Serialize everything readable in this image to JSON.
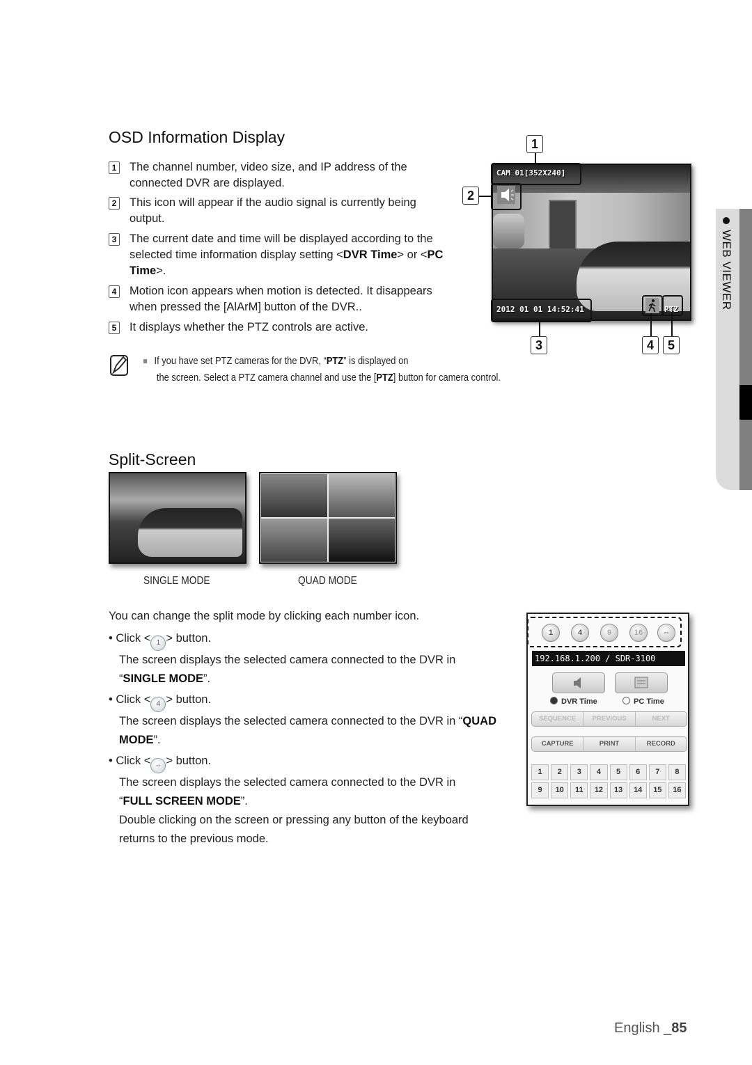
{
  "osd": {
    "title": "OSD Information Display",
    "items": [
      {
        "num": "1",
        "text": "The channel number, video size, and IP address of the connected DVR are displayed."
      },
      {
        "num": "2",
        "text": "This icon will appear if the audio signal is currently being output."
      },
      {
        "num": "3",
        "text_before": "The current date and time will be displayed according to the selected time information display setting <",
        "bold1": "DVR Time",
        "text_mid": "> or <",
        "bold2": "PC Time",
        "text_after": ">."
      },
      {
        "num": "4",
        "text": "Motion icon appears when motion is detected. It disappears when pressed the [AlArM] button of the DVR.."
      },
      {
        "num": "5",
        "text": "It displays whether the PTZ controls are active."
      }
    ],
    "camera": {
      "cam_label": "CAM 01[352X240]",
      "datetime": "2012 01 01  14:52:41",
      "ptz_label": "PTZ",
      "icons": [
        "speaker-icon",
        "motion-person-icon"
      ]
    },
    "callouts": [
      "1",
      "2",
      "3",
      "4",
      "5"
    ]
  },
  "note": {
    "icon": "note-pencil-icon",
    "line1_before": "If you have set PTZ cameras for the DVR, “",
    "line1_bold": "PTZ",
    "line1_after": "” is displayed on",
    "line2_before": "the screen. Select a PTZ camera channel and use the [",
    "line2_bold": "PTZ",
    "line2_after": "] button for camera control."
  },
  "split": {
    "title": "Split-Screen",
    "single_label": "SINGLE MODE",
    "quad_label": "QUAD MODE",
    "intro": "You can change the split mode by clicking each number icon.",
    "bullets": [
      {
        "click": "Click <",
        "icon_label": "1",
        "after": "> button.",
        "desc": "The screen displays the selected camera connected to the DVR in",
        "mode_open": "“",
        "mode": "SINGLE MODE",
        "mode_close": "”."
      },
      {
        "click": "Click <",
        "icon_label": "4",
        "after": "> button.",
        "desc": "The screen displays the selected camera connected to the DVR in “",
        "mode": "QUAD",
        "mode2": "MODE",
        "mode_close": "”."
      },
      {
        "click": "Click <",
        "icon_label": "",
        "after": "> button.",
        "desc": "The screen displays the selected camera connected to the DVR in",
        "mode_open": "“",
        "mode": "FULL SCREEN MODE",
        "mode_close": "”.",
        "extra1": "Double clicking on the screen or pressing any button of the keyboard",
        "extra2": "returns to the previous mode."
      }
    ]
  },
  "panel": {
    "split_buttons": [
      "1",
      "4",
      "9",
      "16"
    ],
    "ip": "192.168.1.200   / SDR-3100",
    "radio": [
      {
        "label": "DVR Time",
        "selected": true
      },
      {
        "label": "PC Time",
        "selected": false
      }
    ],
    "row1": [
      "SEQUENCE",
      "PREVIOUS",
      "NEXT"
    ],
    "row2": [
      "CAPTURE",
      "PRINT",
      "RECORD"
    ],
    "channels": [
      "1",
      "2",
      "3",
      "4",
      "5",
      "6",
      "7",
      "8",
      "9",
      "10",
      "11",
      "12",
      "13",
      "14",
      "15",
      "16"
    ]
  },
  "side_tab": {
    "label": "WEB VIEWER"
  },
  "footer": {
    "lang": "English _",
    "page": "85"
  }
}
